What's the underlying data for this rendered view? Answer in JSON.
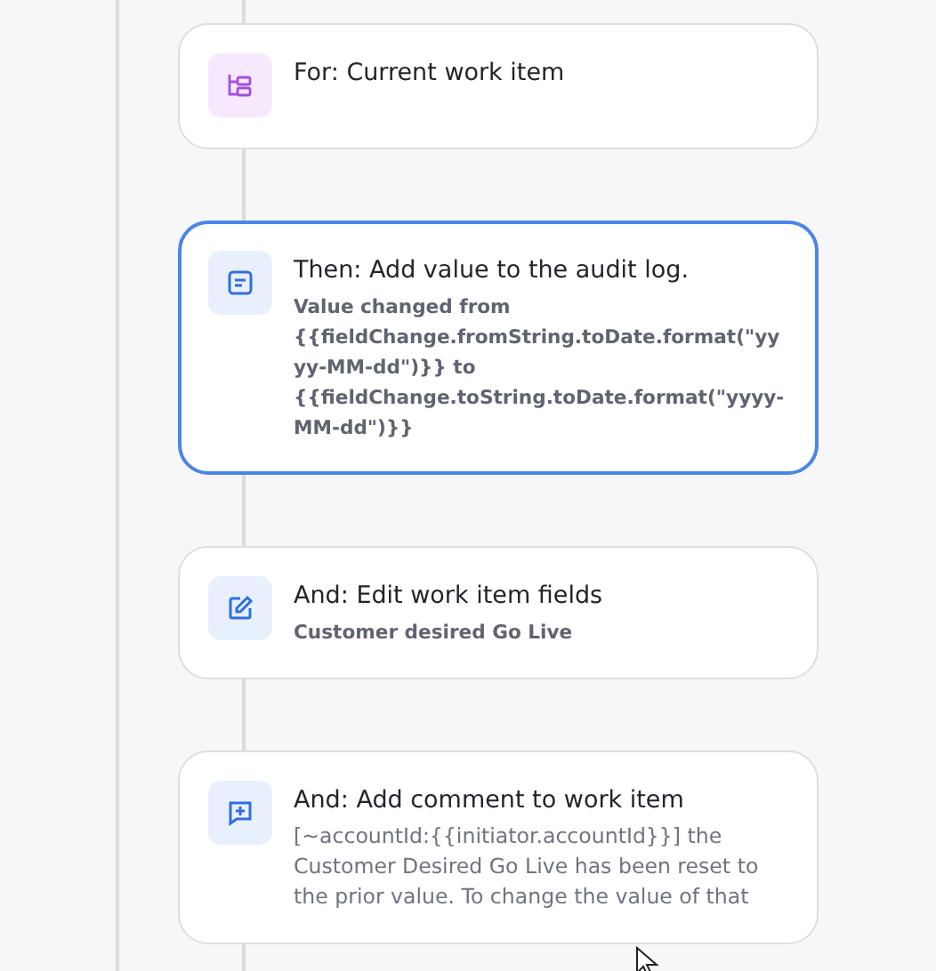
{
  "steps": [
    {
      "kind": "for",
      "selected": false,
      "title": "For: Current work item"
    },
    {
      "kind": "log",
      "selected": true,
      "title": "Then: Add value to the audit log.",
      "description": [
        "Value changed from",
        "{{fieldChange.fromString.toDate.format(\"yy",
        "yy-MM-dd\")}} to",
        "{{fieldChange.toString.toDate.format(\"yyyy-",
        "MM-dd\")}}"
      ]
    },
    {
      "kind": "edit",
      "selected": false,
      "title": "And: Edit work item fields",
      "description": [
        "Customer desired Go Live"
      ]
    },
    {
      "kind": "comment",
      "selected": false,
      "title": "And: Add comment to work item",
      "description": [
        "[~accountId:{{initiator.accountId}}] the",
        "Customer Desired Go Live has been reset to",
        "the prior value. To change the value of that"
      ]
    }
  ]
}
